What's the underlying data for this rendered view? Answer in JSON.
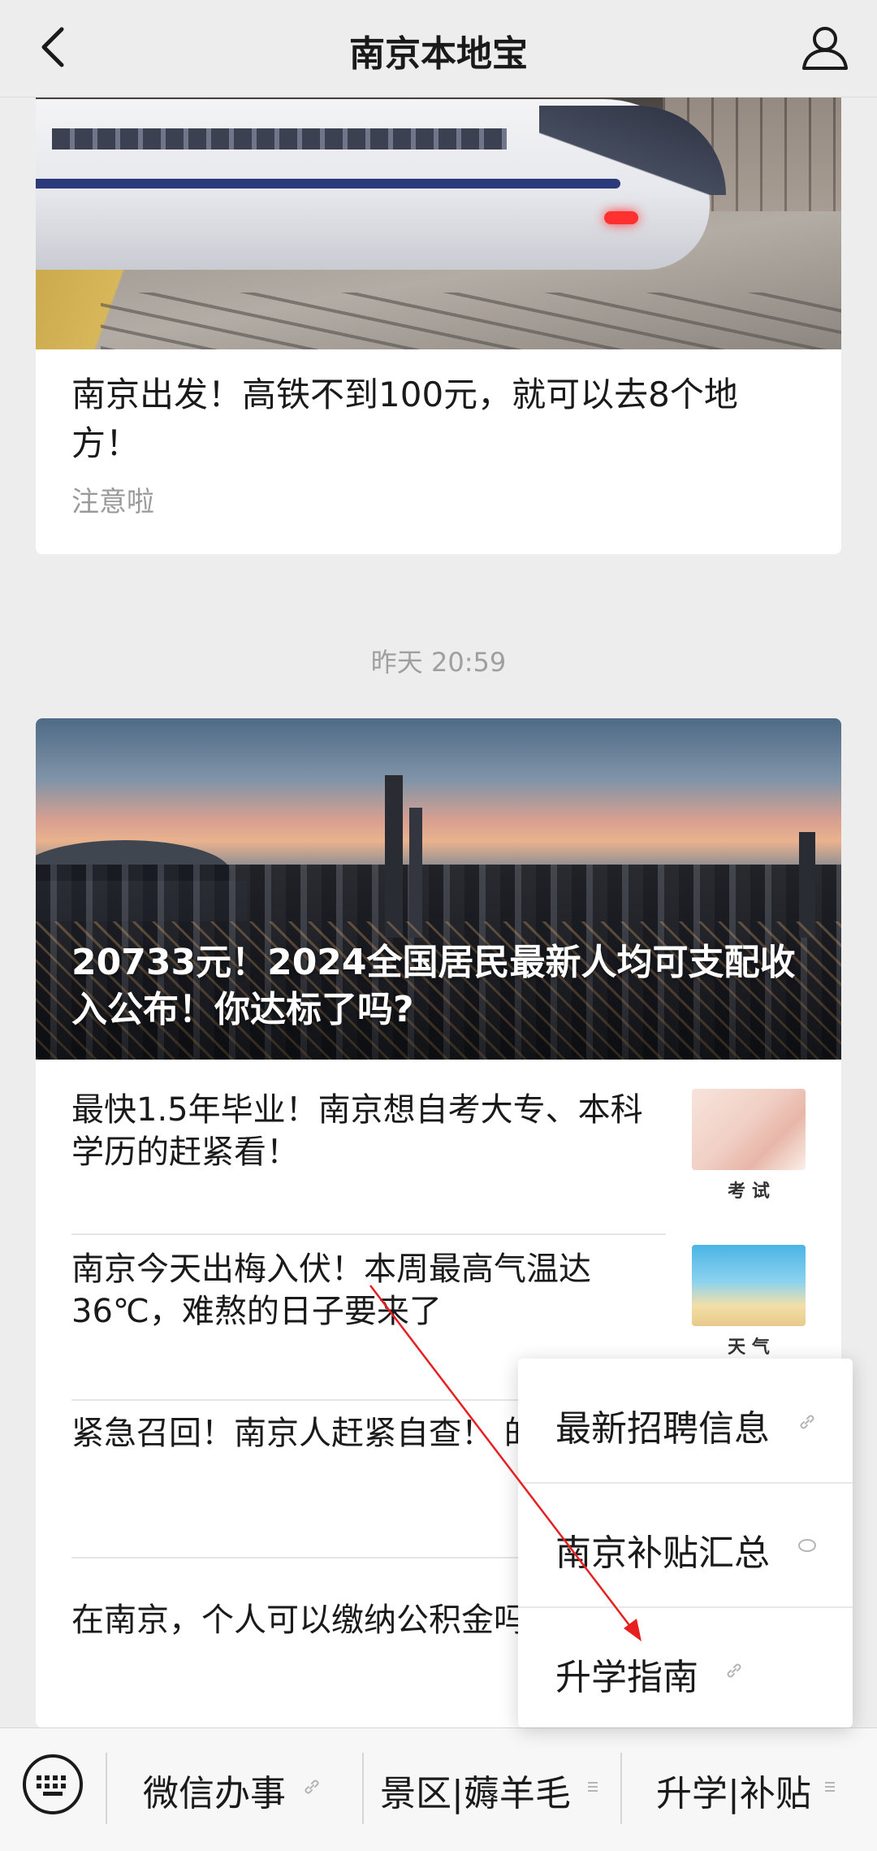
{
  "nav": {
    "title": "南京本地宝"
  },
  "article_top": {
    "title": "南京出发！高铁不到100元，就可以去8个地方！",
    "subtitle": "注意啦"
  },
  "timestamp": "昨天 20:59",
  "article_group": {
    "headline": "20733元！2024全国居民最新人均可支配收入公布！你达标了吗?",
    "items": [
      {
        "title": "最快1.5年毕业！南京想自考大专、本科学历的赶紧看！",
        "thumb_caption": "考 试"
      },
      {
        "title": "南京今天出梅入伏！本周最高气温达36℃，难熬的日子要来了",
        "thumb_caption": "天 气"
      },
      {
        "title": "紧急召回！南京人赶紧自查！ 的爱车?"
      },
      {
        "title": "在南京，个人可以缴纳公积金吗"
      }
    ]
  },
  "popup_menu": {
    "items": [
      {
        "label": "最新招聘信息",
        "icon": "link-icon"
      },
      {
        "label": "南京补贴汇总",
        "icon": "chat-bubble-icon"
      },
      {
        "label": "升学指南",
        "icon": "link-icon"
      }
    ]
  },
  "bottom_menu": {
    "items": [
      {
        "label": "微信办事",
        "icon": "link-icon"
      },
      {
        "label": "景区|薅羊毛",
        "icon": "menu-lines-icon"
      },
      {
        "label": "升学|补贴",
        "icon": "menu-lines-icon"
      }
    ]
  },
  "colors": {
    "background": "#ededed",
    "card": "#ffffff",
    "annotation_arrow": "#e62020"
  }
}
